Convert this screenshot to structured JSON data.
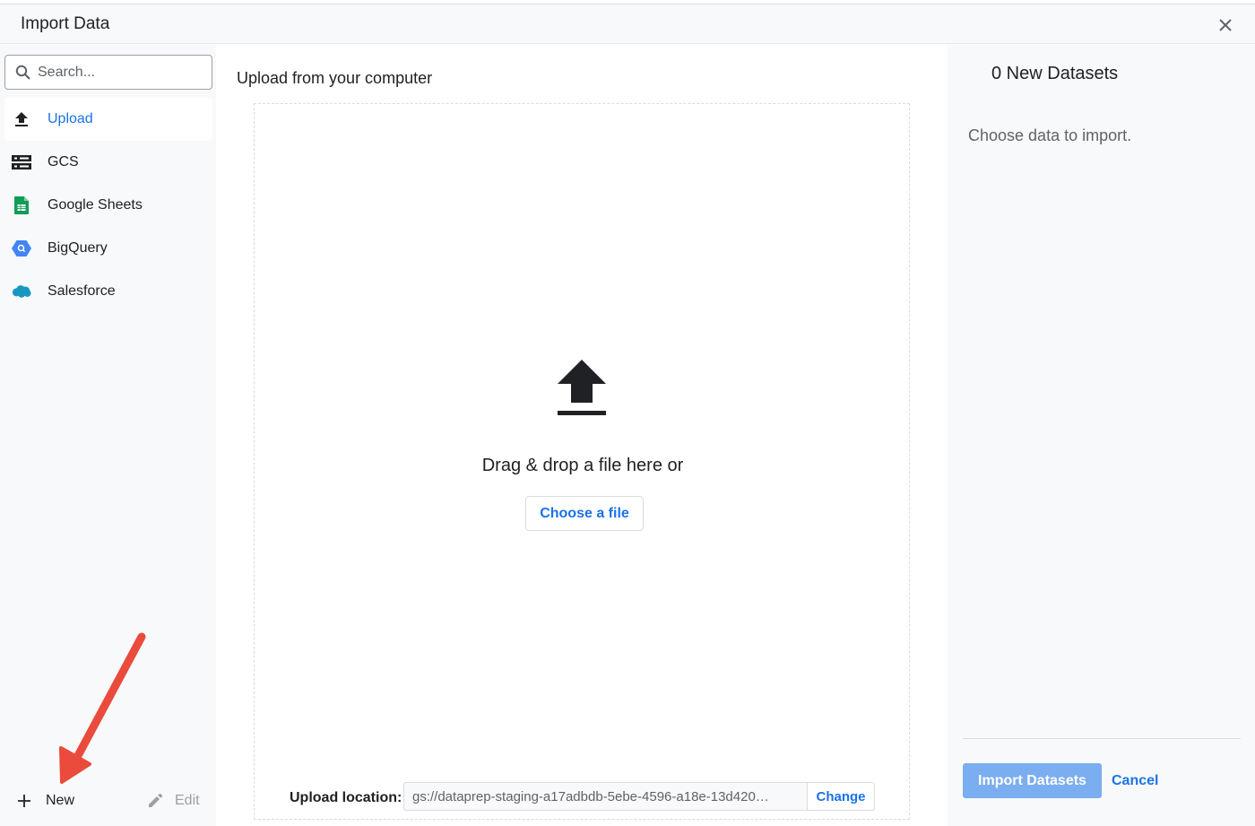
{
  "dialog": {
    "title": "Import Data"
  },
  "sidebar": {
    "search": {
      "placeholder": "Search..."
    },
    "items": [
      {
        "label": "Upload",
        "icon": "upload-icon",
        "active": true
      },
      {
        "label": "GCS",
        "icon": "gcs-storage-icon"
      },
      {
        "label": "Google Sheets",
        "icon": "google-sheets-icon"
      },
      {
        "label": "BigQuery",
        "icon": "bigquery-icon"
      },
      {
        "label": "Salesforce",
        "icon": "salesforce-cloud-icon"
      }
    ],
    "footer": {
      "new_label": "New",
      "edit_label": "Edit"
    }
  },
  "main": {
    "heading": "Upload from your computer",
    "dropzone": {
      "prompt": "Drag & drop a file here or",
      "choose_label": "Choose a file"
    },
    "upload_location": {
      "label": "Upload location:",
      "value": "gs://dataprep-staging-a17adbdb-5ebe-4596-a18e-13d420…",
      "change_label": "Change"
    }
  },
  "right_panel": {
    "count_text": "0 New Datasets",
    "hint": "Choose data to import.",
    "import_label": "Import Datasets",
    "cancel_label": "Cancel"
  },
  "colors": {
    "accent": "#1a73e8",
    "import_button_disabled": "#7aaef0",
    "annotation_arrow": "#ea4b3c",
    "sheets_green": "#0f9d58",
    "bigquery_blue": "#4285f4",
    "salesforce_blue": "#1798c1"
  }
}
